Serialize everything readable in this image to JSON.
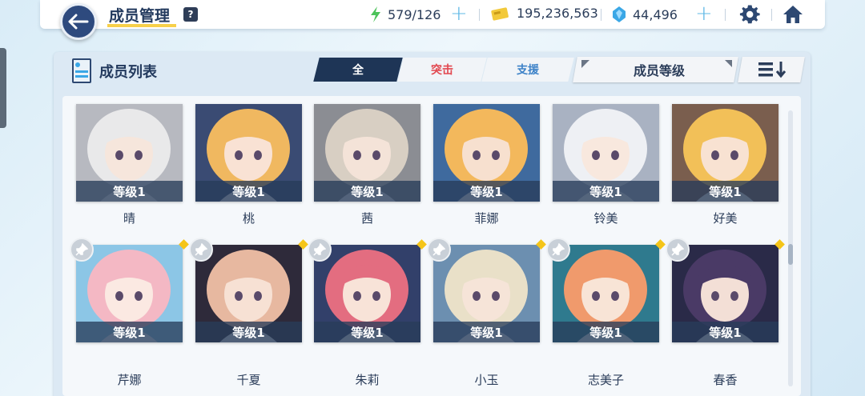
{
  "header": {
    "title": "成员管理",
    "help_label": "?",
    "stamina": "579/126",
    "credits": "195,236,563",
    "gems": "44,496",
    "plus_symbol": "+",
    "colors": {
      "accent": "#f7d04a",
      "navy": "#233a5e",
      "plus": "#5fb8e6"
    }
  },
  "panel": {
    "title": "成员列表",
    "tabs": [
      {
        "label": "全",
        "active": true
      },
      {
        "label": "突击",
        "active": false
      },
      {
        "label": "支援",
        "active": false
      }
    ],
    "sort_label": "成员等级",
    "order_icon": "list-sort-descending-icon"
  },
  "members": [
    {
      "name": "晴",
      "level": "等级1",
      "pinned": false,
      "bg": "#b7b9c0",
      "hair": "#e9e9ea",
      "skin": "#f6e6dc"
    },
    {
      "name": "桃",
      "level": "等级1",
      "pinned": false,
      "bg": "#3a4b73",
      "hair": "#f0b860",
      "skin": "#f9e2d4"
    },
    {
      "name": "茜",
      "level": "等级1",
      "pinned": false,
      "bg": "#8b8d93",
      "hair": "#d8cfc3",
      "skin": "#f4e3d8"
    },
    {
      "name": "菲娜",
      "level": "等级1",
      "pinned": false,
      "bg": "#3f6a9e",
      "hair": "#f3b85c",
      "skin": "#f7e0cf"
    },
    {
      "name": "铃美",
      "level": "等级1",
      "pinned": false,
      "bg": "#a9b2c2",
      "hair": "#eef0f4",
      "skin": "#f8e8de"
    },
    {
      "name": "好美",
      "level": "等级1",
      "pinned": false,
      "bg": "#7a5e4e",
      "hair": "#f2c058",
      "skin": "#f8e2d2"
    },
    {
      "name": "芹娜",
      "level": "等级1",
      "pinned": true,
      "bg": "#8cc6e6",
      "hair": "#f4b8c4",
      "skin": "#fbe9e2"
    },
    {
      "name": "千夏",
      "level": "等级1",
      "pinned": true,
      "bg": "#2e2a3a",
      "hair": "#e7b8a0",
      "skin": "#f7e1d4"
    },
    {
      "name": "朱莉",
      "level": "等级1",
      "pinned": true,
      "bg": "#32406a",
      "hair": "#e36d80",
      "skin": "#f8e3d8"
    },
    {
      "name": "小玉",
      "level": "等级1",
      "pinned": true,
      "bg": "#6c8fb0",
      "hair": "#e9e0c8",
      "skin": "#f6e4d8"
    },
    {
      "name": "志美子",
      "level": "等级1",
      "pinned": true,
      "bg": "#2f7a8e",
      "hair": "#f09a6c",
      "skin": "#f8e4d6"
    },
    {
      "name": "春香",
      "level": "等级1",
      "pinned": true,
      "bg": "#2a2a48",
      "hair": "#4a3a66",
      "skin": "#f3dfd6"
    }
  ]
}
